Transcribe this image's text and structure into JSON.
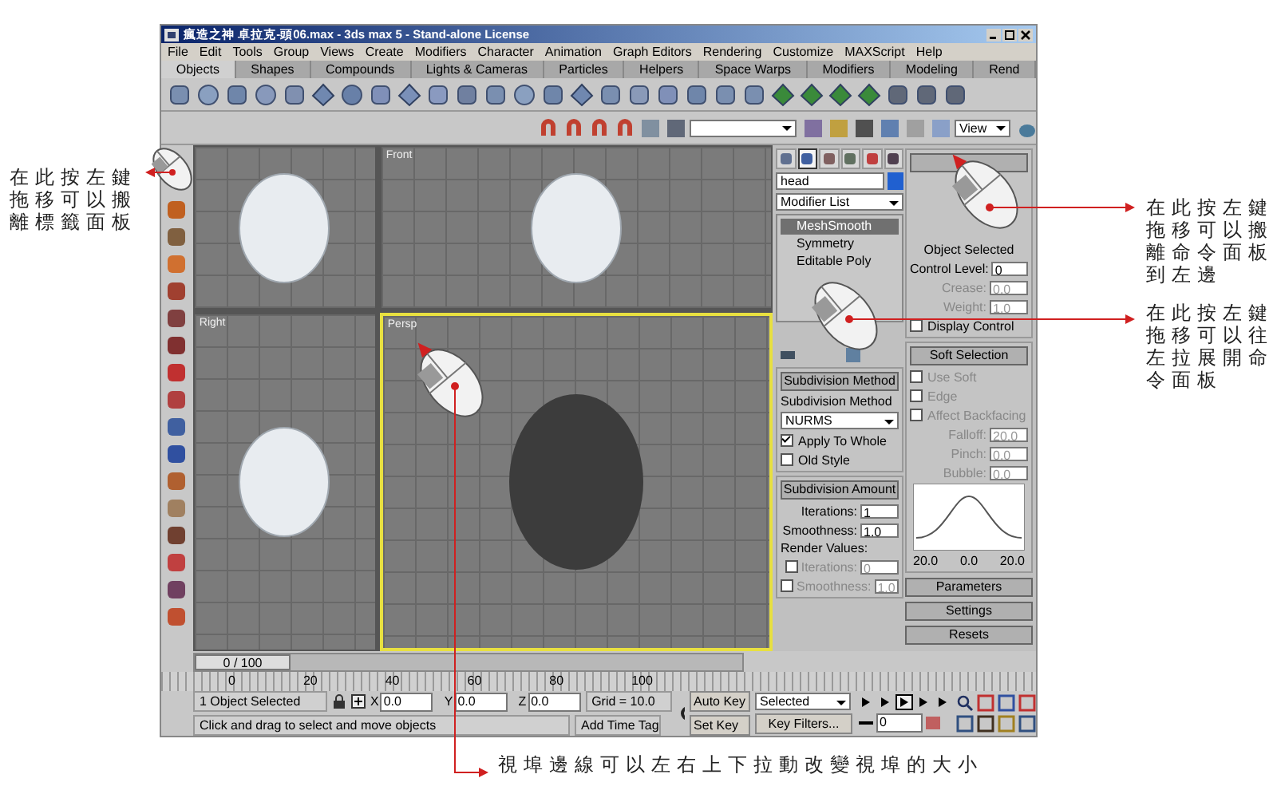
{
  "window": {
    "title": "瘋造之神 卓拉克-頭06.max - 3ds max 5 - Stand-alone License"
  },
  "menu": [
    "File",
    "Edit",
    "Tools",
    "Group",
    "Views",
    "Create",
    "Modifiers",
    "Character",
    "Animation",
    "Graph Editors",
    "Rendering",
    "Customize",
    "MAXScript",
    "Help"
  ],
  "tabs": [
    {
      "label": "Objects",
      "selected": true
    },
    {
      "label": "Shapes",
      "selected": false
    },
    {
      "label": "Compounds",
      "selected": false
    },
    {
      "label": "Lights & Cameras",
      "selected": false
    },
    {
      "label": "Particles",
      "selected": false
    },
    {
      "label": "Helpers",
      "selected": false
    },
    {
      "label": "Space Warps",
      "selected": false
    },
    {
      "label": "Modifiers",
      "selected": false
    },
    {
      "label": "Modeling",
      "selected": false
    },
    {
      "label": "Rend",
      "selected": false
    }
  ],
  "main_toolbar": {
    "view_dropdown": "View"
  },
  "viewports": [
    {
      "selected": false
    },
    {
      "label": "Front",
      "selected": false
    },
    {
      "label": "Right",
      "selected": false
    },
    {
      "label": "Persp",
      "selected": true
    }
  ],
  "command_panel": {
    "tabs": [
      {
        "selected": false
      },
      {
        "selected": true
      },
      {
        "selected": false
      },
      {
        "selected": false
      },
      {
        "selected": false
      },
      {
        "selected": false
      }
    ],
    "object_name": "head",
    "modifier_list": "Modifier List",
    "stack": [
      {
        "label": "MeshSmooth",
        "selected": true
      },
      {
        "label": "Symmetry",
        "selected": false
      },
      {
        "label": "Editable Poly",
        "selected": false
      }
    ],
    "local_control": {
      "label": "Object Selected",
      "fields": [
        {
          "label": "Control Level:",
          "value": "0",
          "disabled": false
        },
        {
          "label": "Crease:",
          "value": "0.0",
          "disabled": true
        },
        {
          "label": "Weight:",
          "value": "1.0",
          "disabled": true
        }
      ],
      "display_control": {
        "label": "Display Control",
        "checked": false
      }
    },
    "subdivision_method": {
      "title": "Subdivision Method",
      "label": "Subdivision Method",
      "method": "NURMS",
      "options": [
        {
          "label": "Apply To Whole",
          "checked": true
        },
        {
          "label": "Old Style",
          "checked": false
        }
      ]
    },
    "subdivision_amount": {
      "title": "Subdivision Amount",
      "fields": [
        {
          "label": "Iterations:",
          "value": "1"
        },
        {
          "label": "Smoothness:",
          "value": "1.0"
        }
      ],
      "render_label": "Render Values:",
      "render_fields": [
        {
          "label": "Iterations:",
          "value": "0",
          "checked": false,
          "disabled": true
        },
        {
          "label": "Smoothness:",
          "value": "1.0",
          "checked": false,
          "disabled": true
        }
      ]
    },
    "soft_selection": {
      "title": "Soft Selection",
      "options": [
        {
          "label": "Use Soft",
          "checked": false,
          "disabled": true
        },
        {
          "label": "Edge",
          "checked": false,
          "disabled": true
        },
        {
          "label": "Affect Backfacing",
          "checked": false,
          "disabled": true
        }
      ],
      "fields": [
        {
          "label": "Falloff:",
          "value": "20.0",
          "disabled": true
        },
        {
          "label": "Pinch:",
          "value": "0.0",
          "disabled": true
        },
        {
          "label": "Bubble:",
          "value": "0.0",
          "disabled": true
        }
      ],
      "curve_labels": [
        "20.0",
        "0.0",
        "20.0"
      ]
    },
    "rollups": [
      "Parameters",
      "Settings",
      "Resets"
    ]
  },
  "time_slider": "0 / 100",
  "ruler": [
    "0",
    "20",
    "40",
    "60",
    "80",
    "100"
  ],
  "status": {
    "selection": "1 Object Selected",
    "coords": [
      {
        "axis": "X",
        "value": "0.0"
      },
      {
        "axis": "Y",
        "value": "0.0"
      },
      {
        "axis": "Z",
        "value": "0.0"
      }
    ],
    "grid": "Grid = 10.0",
    "prompt": "Click and drag to select and move objects",
    "time_tag": "Add Time Tag",
    "auto_key": "Auto Key",
    "set_key": "Set Key",
    "key_mode": "Selected",
    "key_filters": "Key Filters...",
    "frame": "0"
  },
  "annotations": {
    "left": "在此按左鍵拖移可以搬離標籤面板",
    "right": [
      "在此按左鍵拖移可以搬離命令面板到左邊",
      "在此按左鍵拖移可以往左拉展開命令面板"
    ],
    "bottom": "視埠邊線可以左右上下拉動改變視埠的大小"
  }
}
